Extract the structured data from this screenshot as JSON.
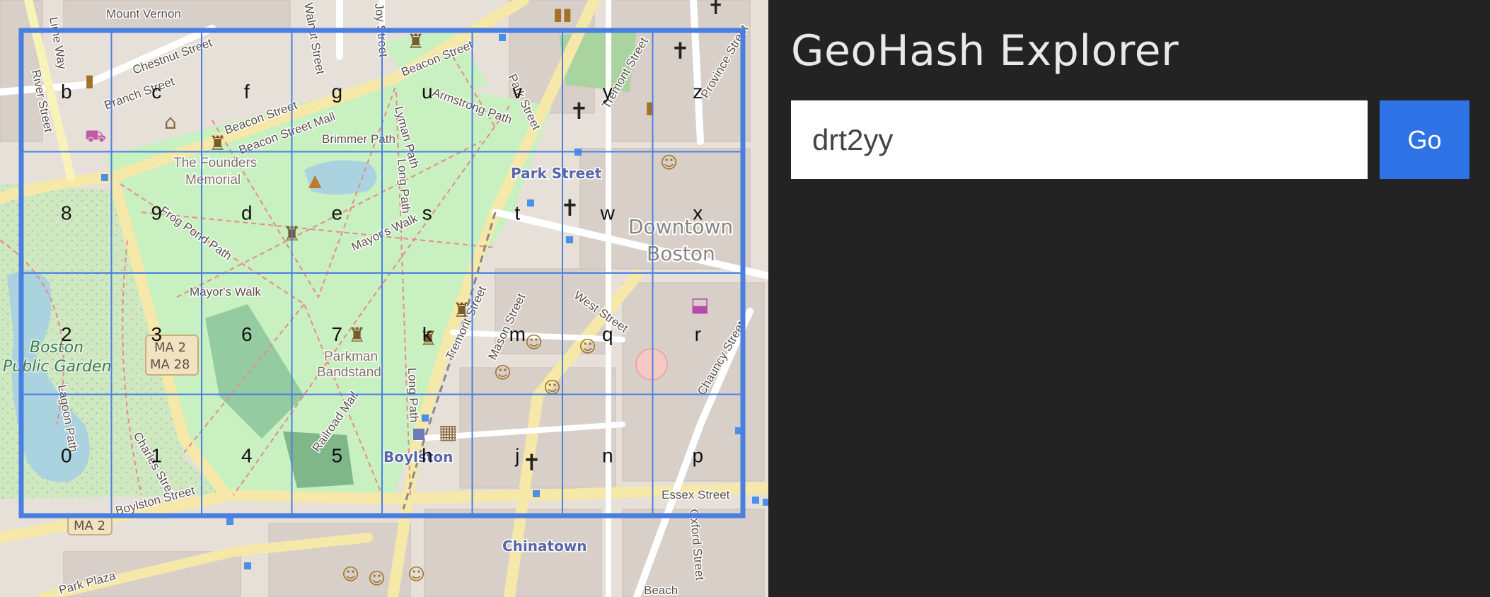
{
  "app": {
    "title": "GeoHash Explorer",
    "accent_color": "#2d73e6"
  },
  "search": {
    "value": "drt2yy",
    "placeholder": "",
    "go_label": "Go"
  },
  "map": {
    "grid_color": "#4a7fe0",
    "grid_cells": [
      [
        "b",
        "c",
        "f",
        "g",
        "u",
        "v",
        "y",
        "z"
      ],
      [
        "8",
        "9",
        "d",
        "e",
        "s",
        "t",
        "w",
        "x"
      ],
      [
        "2",
        "3",
        "6",
        "7",
        "k",
        "m",
        "q",
        "r"
      ],
      [
        "0",
        "1",
        "4",
        "5",
        "h",
        "j",
        "n",
        "p"
      ]
    ],
    "street_labels": [
      "Mount Vernon",
      "Lime Way",
      "Chestnut Street",
      "Walnut Street",
      "Joy Street",
      "Beacon Street",
      "River Street",
      "Branch Street",
      "Beacon Street",
      "Beacon Street Mall",
      "Brimmer Path",
      "Armstrong Path",
      "Park Street",
      "Tremont Street",
      "Province Street",
      "Lyman Path",
      "Long Path",
      "Frog Pond Path",
      "Mayor's Walk",
      "Mayor's Walk",
      "Tremont Street",
      "West Street",
      "Mason Street",
      "Chauncy Street",
      "Lagoon Path",
      "Charles Street",
      "Railroad Mall",
      "Long Path",
      "Boylston Street",
      "Essex Street",
      "Oxford Street",
      "Park Plaza",
      "Beach"
    ],
    "place_labels": [
      "The Founders",
      "Memorial",
      "Parkman",
      "Bandstand"
    ],
    "area_labels": [
      "Downtown",
      "Boston"
    ],
    "park_labels": [
      "Boston",
      "Public Garden"
    ],
    "transit_labels": [
      "Park Street",
      "Boylston",
      "Chinatown"
    ],
    "route_shields": [
      "MA 2",
      "MA 28",
      "MA 2"
    ]
  }
}
